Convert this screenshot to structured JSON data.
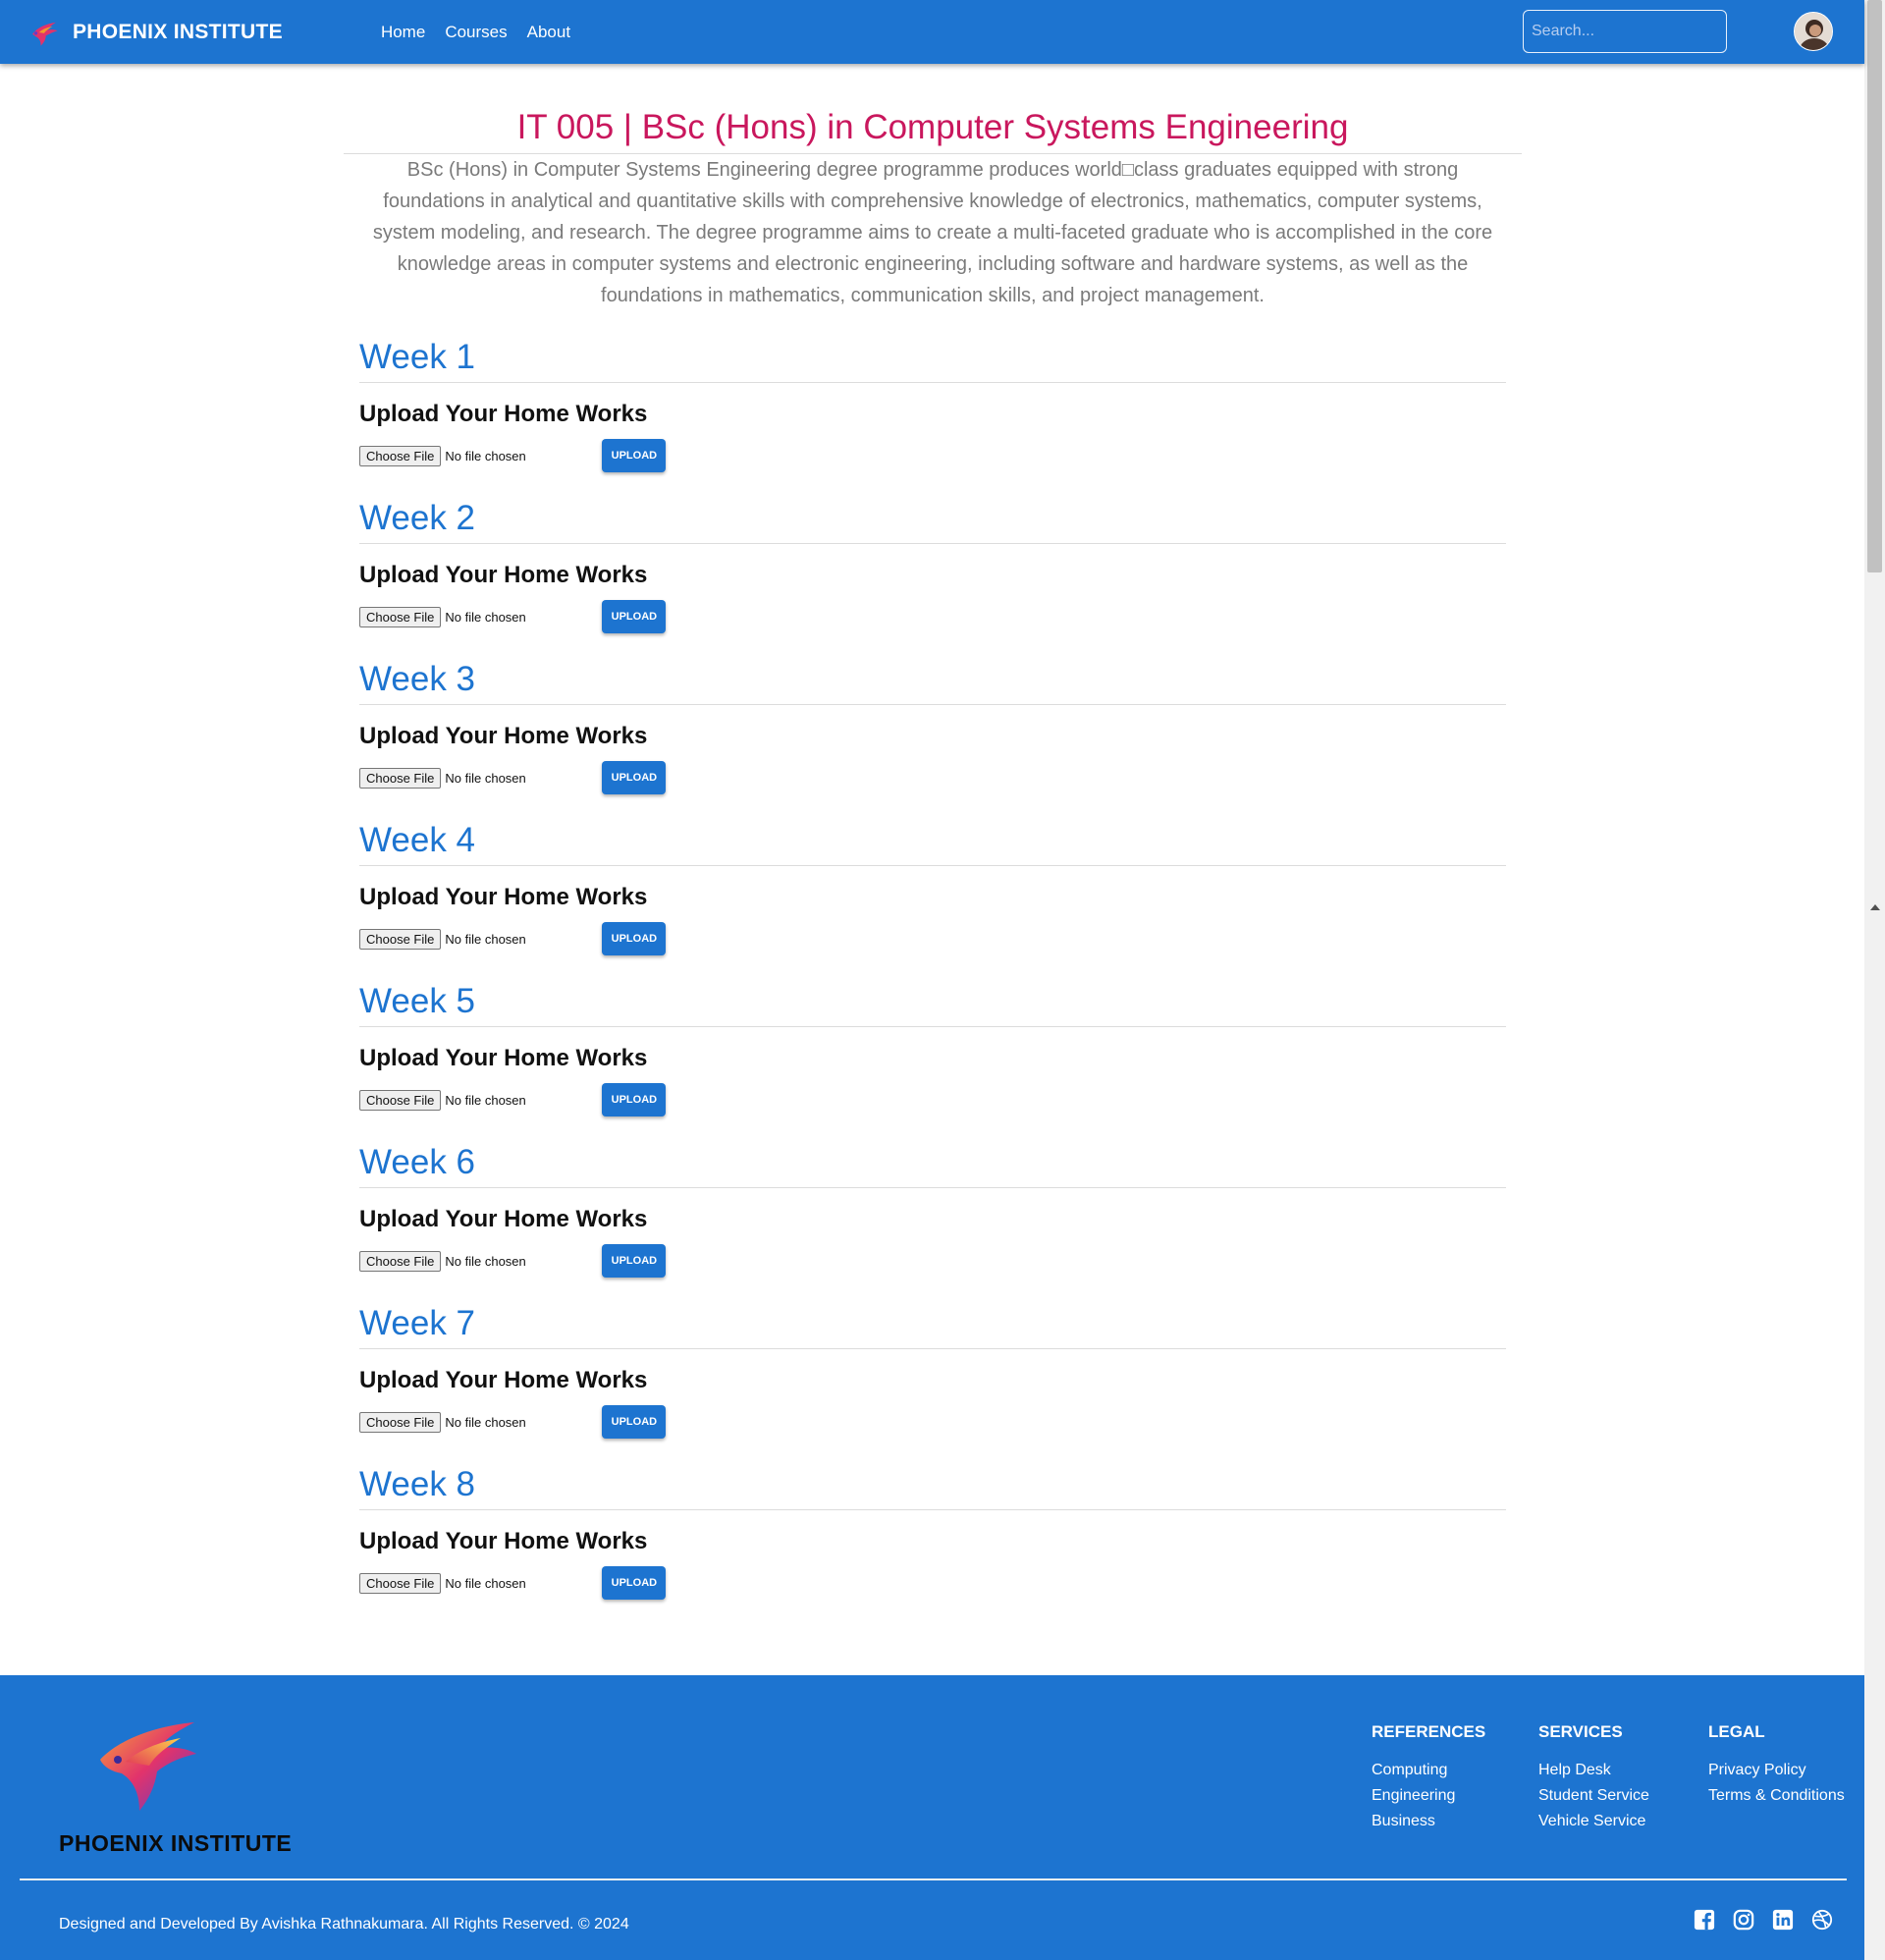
{
  "navbar": {
    "brand": "PHOENIX INSTITUTE",
    "links": [
      "Home",
      "Courses",
      "About"
    ],
    "search_placeholder": "Search..."
  },
  "course": {
    "title": "IT 005 | BSc (Hons) in Computer Systems Engineering",
    "description": "BSc (Hons) in Computer Systems Engineering degree programme produces world□class graduates equipped with strong foundations in analytical and quantitative skills with comprehensive knowledge of electronics, mathematics, computer systems, system modeling, and research. The degree programme aims to create a multi-faceted graduate who is accomplished in the core knowledge areas in computer systems and electronic engineering, including software and hardware systems, as well as the foundations in mathematics, communication skills, and project management."
  },
  "weeks": [
    {
      "title": "Week 1",
      "upload_heading": "Upload Your Home Works",
      "choose_label": "Choose File",
      "file_status": "No file chosen",
      "upload_label": "UPLOAD"
    },
    {
      "title": "Week 2",
      "upload_heading": "Upload Your Home Works",
      "choose_label": "Choose File",
      "file_status": "No file chosen",
      "upload_label": "UPLOAD"
    },
    {
      "title": "Week 3",
      "upload_heading": "Upload Your Home Works",
      "choose_label": "Choose File",
      "file_status": "No file chosen",
      "upload_label": "UPLOAD"
    },
    {
      "title": "Week 4",
      "upload_heading": "Upload Your Home Works",
      "choose_label": "Choose File",
      "file_status": "No file chosen",
      "upload_label": "UPLOAD"
    },
    {
      "title": "Week 5",
      "upload_heading": "Upload Your Home Works",
      "choose_label": "Choose File",
      "file_status": "No file chosen",
      "upload_label": "UPLOAD"
    },
    {
      "title": "Week 6",
      "upload_heading": "Upload Your Home Works",
      "choose_label": "Choose File",
      "file_status": "No file chosen",
      "upload_label": "UPLOAD"
    },
    {
      "title": "Week 7",
      "upload_heading": "Upload Your Home Works",
      "choose_label": "Choose File",
      "file_status": "No file chosen",
      "upload_label": "UPLOAD"
    },
    {
      "title": "Week 8",
      "upload_heading": "Upload Your Home Works",
      "choose_label": "Choose File",
      "file_status": "No file chosen",
      "upload_label": "UPLOAD"
    }
  ],
  "footer": {
    "brand": "PHOENIX INSTITUTE",
    "columns": [
      {
        "heading": "REFERENCES",
        "links": [
          "Computing",
          "Engineering",
          "Business"
        ]
      },
      {
        "heading": "SERVICES",
        "links": [
          "Help Desk",
          "Student Service",
          "Vehicle Service"
        ]
      },
      {
        "heading": "LEGAL",
        "links": [
          "Privacy Policy",
          "Terms & Conditions"
        ]
      }
    ],
    "copyright": "Designed and Developed By Avishka Rathnakumara. All Rights Reserved. © 2024",
    "socials": [
      "facebook-icon",
      "instagram-icon",
      "linkedin-icon",
      "dribbble-icon"
    ]
  },
  "colors": {
    "brand_blue": "#1d74d0",
    "title_magenta": "#c9175d"
  }
}
